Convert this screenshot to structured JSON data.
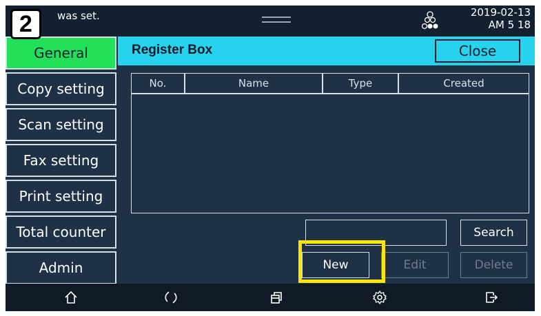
{
  "status": {
    "message": "was set.",
    "date": "2019-02-13",
    "time": "AM 5  18"
  },
  "step_badge": "2",
  "sidebar": {
    "items": [
      {
        "label": "General",
        "active": true
      },
      {
        "label": "Copy setting",
        "active": false
      },
      {
        "label": "Scan setting",
        "active": false
      },
      {
        "label": "Fax setting",
        "active": false
      },
      {
        "label": "Print setting",
        "active": false
      },
      {
        "label": "Total counter",
        "active": false
      },
      {
        "label": "Admin",
        "active": false
      }
    ]
  },
  "header": {
    "title": "Register Box",
    "close_label": "Close"
  },
  "table": {
    "columns": [
      "No.",
      "Name",
      "Type",
      "Created"
    ],
    "rows": []
  },
  "search": {
    "value": "",
    "button_label": "Search"
  },
  "actions": {
    "new_label": "New",
    "edit_label": "Edit",
    "delete_label": "Delete"
  },
  "navbar": {
    "icons": [
      "home-icon",
      "rotate-icon",
      "copy-stack-icon",
      "gear-icon",
      "exit-icon"
    ]
  },
  "colors": {
    "accent": "#27d2ef",
    "active_tab": "#22e05a",
    "background": "#1e3147",
    "highlight": "#ffe600"
  }
}
